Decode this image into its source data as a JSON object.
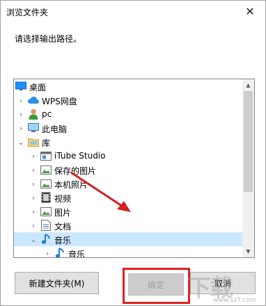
{
  "window": {
    "title": "浏览文件夹",
    "close_glyph": "✕"
  },
  "prompt": "请选择输出路径。",
  "tree": {
    "items": [
      {
        "label": "桌面",
        "icon": "desktop-icon",
        "expander": ""
      },
      {
        "label": "WPS网盘",
        "icon": "cloud-icon",
        "expander": "›"
      },
      {
        "label": "pc",
        "icon": "user-icon",
        "expander": "›"
      },
      {
        "label": "此电脑",
        "icon": "computer-icon",
        "expander": "›"
      },
      {
        "label": "库",
        "icon": "library-icon",
        "expander": "⌄"
      },
      {
        "label": "iTube Studio",
        "icon": "folder-window-icon",
        "expander": "›"
      },
      {
        "label": "保存的图片",
        "icon": "picture-folder-icon",
        "expander": "›"
      },
      {
        "label": "本机照片",
        "icon": "picture-folder-icon",
        "expander": "›"
      },
      {
        "label": "视频",
        "icon": "video-folder-icon",
        "expander": "›"
      },
      {
        "label": "图片",
        "icon": "picture-folder-icon",
        "expander": "›"
      },
      {
        "label": "文档",
        "icon": "document-folder-icon",
        "expander": "›"
      },
      {
        "label": "音乐",
        "icon": "music-icon",
        "expander": "⌄"
      },
      {
        "label": "音乐",
        "icon": "music-icon",
        "expander": "›"
      }
    ]
  },
  "buttons": {
    "new_folder": "新建文件夹(M)",
    "ok": "确定",
    "cancel": "取消"
  },
  "colors": {
    "selection": "#cce8ff",
    "highlight": "#e02020",
    "music_blue": "#1e7fd6"
  },
  "watermark": {
    "text": "下载",
    "url": "www.xz7.com"
  }
}
